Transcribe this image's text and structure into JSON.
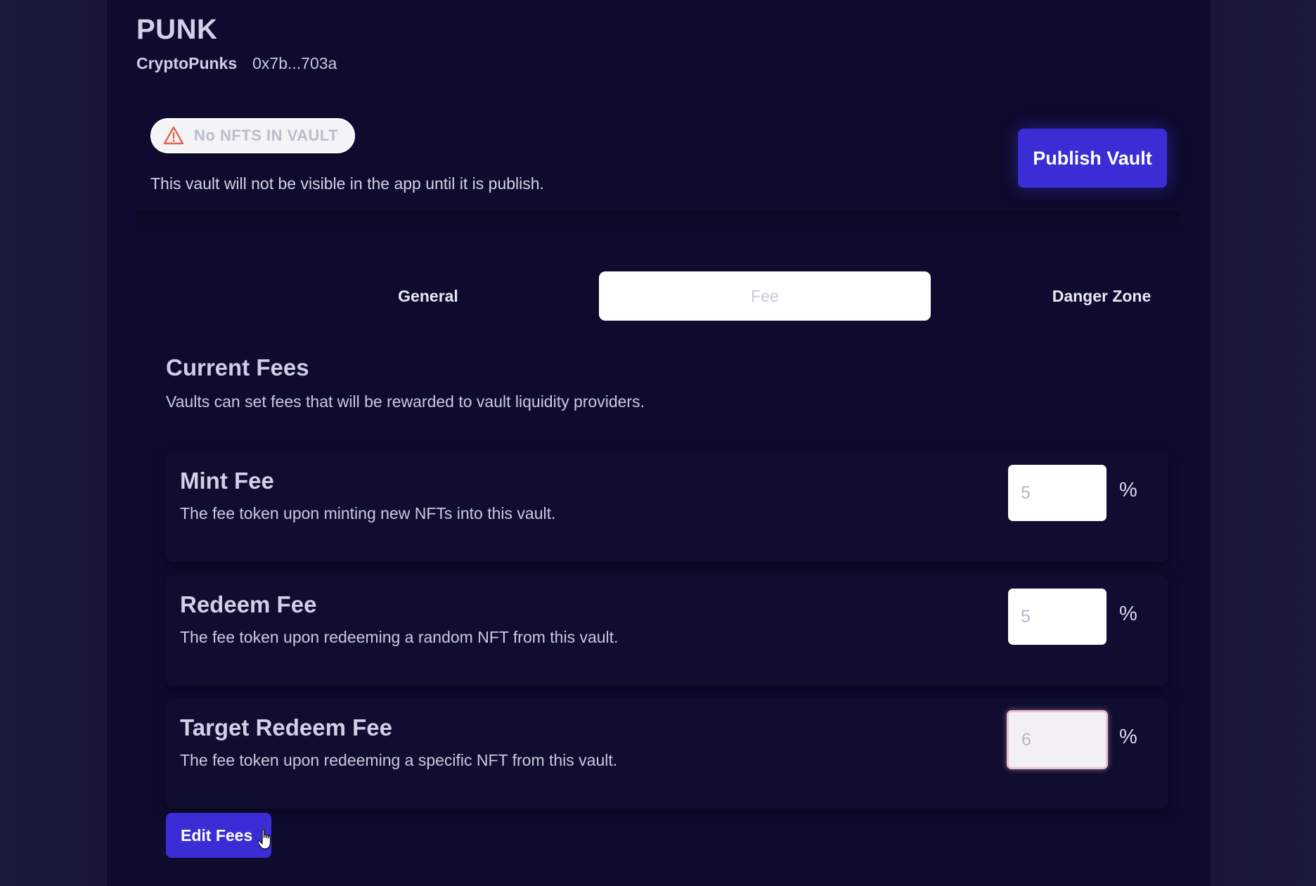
{
  "vault": {
    "symbol": "PUNK",
    "name": "CryptoPunks",
    "address": "0x7b...703a"
  },
  "notice": {
    "badge_icon": "warning-icon",
    "badge_label": "No NFTS IN VAULT",
    "message": "This vault will not be visible in the app until it is publish."
  },
  "actions": {
    "publish_label": "Publish Vault",
    "edit_fees_label": "Edit Fees"
  },
  "tabs": [
    {
      "label": "General",
      "active": false
    },
    {
      "label": "Fee",
      "active": true
    },
    {
      "label": "Danger Zone",
      "active": false
    }
  ],
  "current_fees": {
    "title": "Current Fees",
    "description": "Vaults can set fees that will be rewarded to vault liquidity providers."
  },
  "fees": [
    {
      "title": "Mint Fee",
      "description": "The fee token upon minting new NFTs into this vault.",
      "value": "5",
      "unit": "%"
    },
    {
      "title": "Redeem Fee",
      "description": "The fee token upon redeeming a random NFT from this vault.",
      "value": "5",
      "unit": "%"
    },
    {
      "title": "Target Redeem Fee",
      "description": "The fee token upon redeeming a specific NFT from this vault.",
      "value": "6",
      "unit": "%",
      "focused": true
    }
  ],
  "colors": {
    "background": "#0e0b2e",
    "accent": "#3b2dd6",
    "warning": "#e0664d"
  }
}
